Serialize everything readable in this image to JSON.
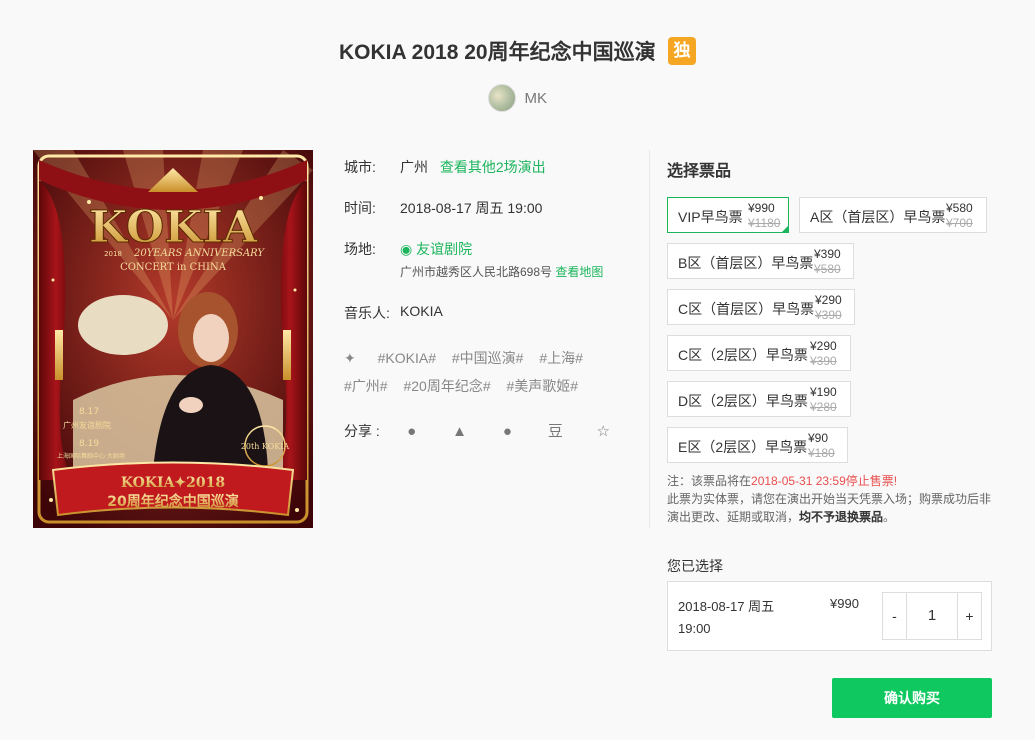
{
  "header": {
    "title": "KOKIA 2018 20周年纪念中国巡演",
    "exclusive_badge": "独",
    "author": "MK"
  },
  "poster": {
    "logo": "KOKIA",
    "subtitle1": "20YEARS ANNIVERSARY",
    "subtitle2": "CONCERT in CHINA",
    "year_tag": "2018",
    "date1": "8.17",
    "venue1": "广州友谊剧院",
    "date2": "8.19",
    "venue2": "上海国际舞蹈中心·大剧场",
    "seal": "20th KOKIA",
    "banner1": "KOKIA✦2018",
    "banner2": "20周年纪念中国巡演"
  },
  "info": {
    "city_label": "城市:",
    "city": "广州",
    "other_shows": "查看其他2场演出",
    "time_label": "时间:",
    "time": "2018-08-17 周五 19:00",
    "venue_label": "场地:",
    "venue": "友谊剧院",
    "address": "广州市越秀区人民北路698号",
    "map_link": "查看地图",
    "musician_label": "音乐人:",
    "musician": "KOKIA",
    "tags": [
      "#KOKIA#",
      "#中国巡演#",
      "#上海#",
      "#广州#",
      "#20周年纪念#",
      "#美声歌姬#"
    ],
    "share_label": "分享 :",
    "share_icons": [
      "weibo-icon",
      "qq-icon",
      "wechat-icon",
      "douban-icon",
      "favorite-icon"
    ],
    "douban_glyph": "豆"
  },
  "tickets": {
    "title": "选择票品",
    "items": [
      {
        "name": "VIP早鸟票",
        "price": "¥990",
        "original": "¥1180",
        "selected": true
      },
      {
        "name": "A区（首层区）早鸟票",
        "price": "¥580",
        "original": "¥700"
      },
      {
        "name": "B区（首层区）早鸟票",
        "price": "¥390",
        "original": "¥580"
      },
      {
        "name": "C区（首层区）早鸟票",
        "price": "¥290",
        "original": "¥390"
      },
      {
        "name": "C区（2层区）早鸟票",
        "price": "¥290",
        "original": "¥390"
      },
      {
        "name": "D区（2层区）早鸟票",
        "price": "¥190",
        "original": "¥280"
      },
      {
        "name": "E区（2层区）早鸟票",
        "price": "¥90",
        "original": "¥180"
      }
    ],
    "note_prefix": "注：该票品将在",
    "note_deadline": "2018-05-31 23:59停止售票!",
    "note_line2": "此票为实体票，请您在演出开始当天凭票入场；购票成功后非",
    "note_line3_a": "演出更改、延期或取消，",
    "note_line3_b": "均不予退换票品",
    "note_line3_c": "。"
  },
  "selection": {
    "title": "您已选择",
    "date": "2018-08-17 周五",
    "time": "19:00",
    "price": "¥990",
    "minus": "-",
    "quantity": "1",
    "plus": "+"
  },
  "confirm_label": "确认购买",
  "colors": {
    "accent_green": "#1bb55c",
    "button_green": "#0fc85f",
    "badge_orange": "#f5a623",
    "warning_red": "#e94e4e"
  }
}
